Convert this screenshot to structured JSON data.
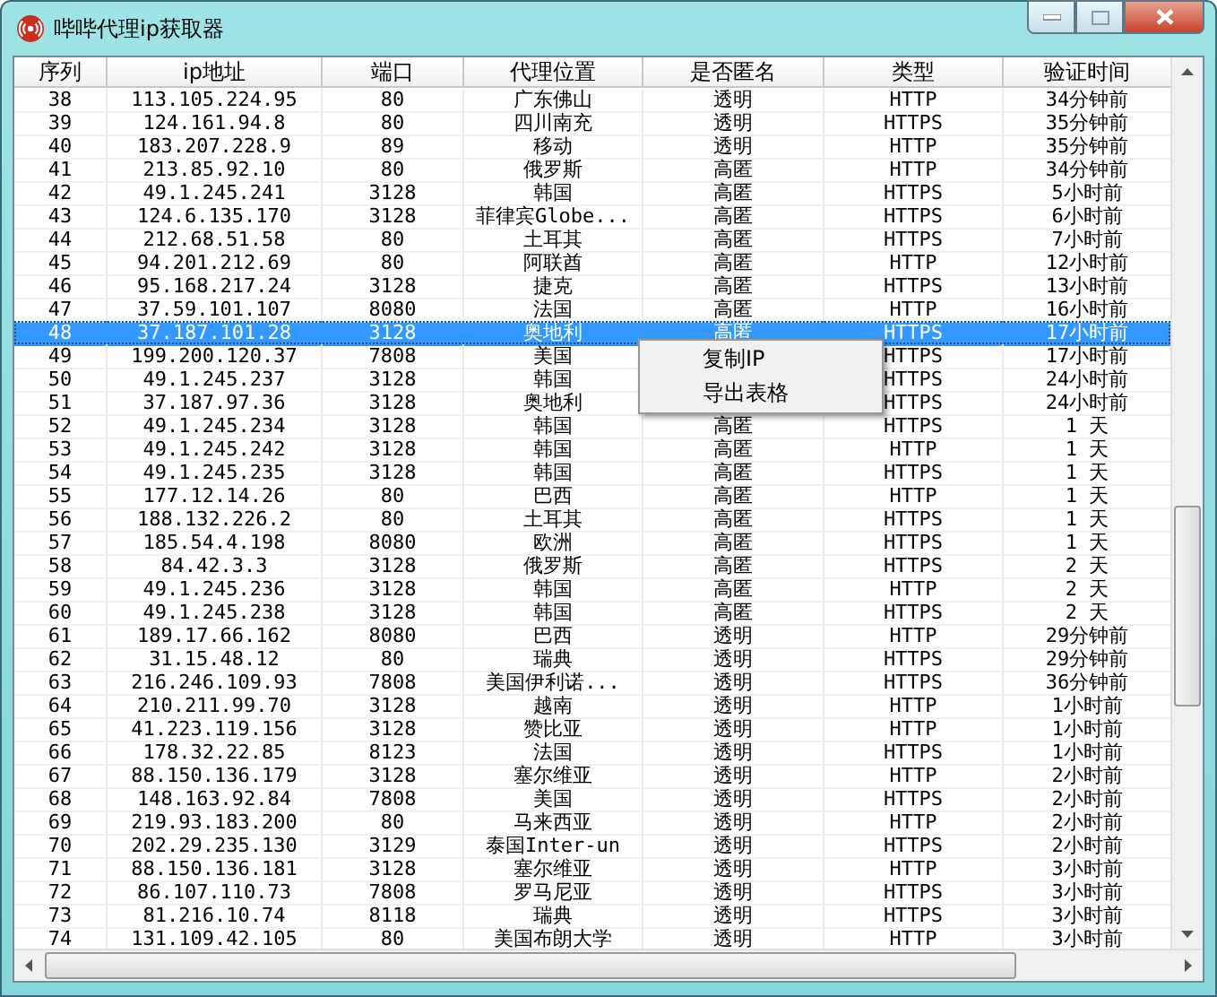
{
  "window": {
    "title": "哔哔代理ip获取器"
  },
  "table": {
    "columns": [
      "序列",
      "ip地址",
      "端口",
      "代理位置",
      "是否匿名",
      "类型",
      "验证时间"
    ],
    "rows": [
      {
        "index": "38",
        "ip": "113.105.224.95",
        "port": "80",
        "location": "广东佛山",
        "anonymity": "透明",
        "type": "HTTP",
        "verified": "34分钟前",
        "selected": false
      },
      {
        "index": "39",
        "ip": "124.161.94.8",
        "port": "80",
        "location": "四川南充",
        "anonymity": "透明",
        "type": "HTTPS",
        "verified": "35分钟前",
        "selected": false
      },
      {
        "index": "40",
        "ip": "183.207.228.9",
        "port": "89",
        "location": "移动",
        "anonymity": "透明",
        "type": "HTTP",
        "verified": "35分钟前",
        "selected": false
      },
      {
        "index": "41",
        "ip": "213.85.92.10",
        "port": "80",
        "location": "俄罗斯",
        "anonymity": "高匿",
        "type": "HTTP",
        "verified": "34分钟前",
        "selected": false
      },
      {
        "index": "42",
        "ip": "49.1.245.241",
        "port": "3128",
        "location": "韩国",
        "anonymity": "高匿",
        "type": "HTTPS",
        "verified": "5小时前",
        "selected": false
      },
      {
        "index": "43",
        "ip": "124.6.135.170",
        "port": "3128",
        "location": "菲律宾Globe...",
        "anonymity": "高匿",
        "type": "HTTPS",
        "verified": "6小时前",
        "selected": false
      },
      {
        "index": "44",
        "ip": "212.68.51.58",
        "port": "80",
        "location": "土耳其",
        "anonymity": "高匿",
        "type": "HTTPS",
        "verified": "7小时前",
        "selected": false
      },
      {
        "index": "45",
        "ip": "94.201.212.69",
        "port": "80",
        "location": "阿联酋",
        "anonymity": "高匿",
        "type": "HTTP",
        "verified": "12小时前",
        "selected": false
      },
      {
        "index": "46",
        "ip": "95.168.217.24",
        "port": "3128",
        "location": "捷克",
        "anonymity": "高匿",
        "type": "HTTPS",
        "verified": "13小时前",
        "selected": false
      },
      {
        "index": "47",
        "ip": "37.59.101.107",
        "port": "8080",
        "location": "法国",
        "anonymity": "高匿",
        "type": "HTTP",
        "verified": "16小时前",
        "selected": false
      },
      {
        "index": "48",
        "ip": "37.187.101.28",
        "port": "3128",
        "location": "奥地利",
        "anonymity": "高匿",
        "type": "HTTPS",
        "verified": "17小时前",
        "selected": true
      },
      {
        "index": "49",
        "ip": "199.200.120.37",
        "port": "7808",
        "location": "美国",
        "type": "HTTPS",
        "verified": "17小时前",
        "selected": false
      },
      {
        "index": "50",
        "ip": "49.1.245.237",
        "port": "3128",
        "location": "韩国",
        "type": "HTTPS",
        "verified": "24小时前",
        "selected": false
      },
      {
        "index": "51",
        "ip": "37.187.97.36",
        "port": "3128",
        "location": "奥地利",
        "type": "HTTPS",
        "verified": "24小时前",
        "selected": false
      },
      {
        "index": "52",
        "ip": "49.1.245.234",
        "port": "3128",
        "location": "韩国",
        "anonymity": "高匿",
        "type": "HTTPS",
        "verified": "1 天",
        "selected": false
      },
      {
        "index": "53",
        "ip": "49.1.245.242",
        "port": "3128",
        "location": "韩国",
        "anonymity": "高匿",
        "type": "HTTP",
        "verified": "1 天",
        "selected": false
      },
      {
        "index": "54",
        "ip": "49.1.245.235",
        "port": "3128",
        "location": "韩国",
        "anonymity": "高匿",
        "type": "HTTPS",
        "verified": "1 天",
        "selected": false
      },
      {
        "index": "55",
        "ip": "177.12.14.26",
        "port": "80",
        "location": "巴西",
        "anonymity": "高匿",
        "type": "HTTP",
        "verified": "1 天",
        "selected": false
      },
      {
        "index": "56",
        "ip": "188.132.226.2",
        "port": "80",
        "location": "土耳其",
        "anonymity": "高匿",
        "type": "HTTPS",
        "verified": "1 天",
        "selected": false
      },
      {
        "index": "57",
        "ip": "185.54.4.198",
        "port": "8080",
        "location": "欧洲",
        "anonymity": "高匿",
        "type": "HTTPS",
        "verified": "1 天",
        "selected": false
      },
      {
        "index": "58",
        "ip": "84.42.3.3",
        "port": "3128",
        "location": "俄罗斯",
        "anonymity": "高匿",
        "type": "HTTPS",
        "verified": "2 天",
        "selected": false
      },
      {
        "index": "59",
        "ip": "49.1.245.236",
        "port": "3128",
        "location": "韩国",
        "anonymity": "高匿",
        "type": "HTTP",
        "verified": "2 天",
        "selected": false
      },
      {
        "index": "60",
        "ip": "49.1.245.238",
        "port": "3128",
        "location": "韩国",
        "anonymity": "高匿",
        "type": "HTTPS",
        "verified": "2 天",
        "selected": false
      },
      {
        "index": "61",
        "ip": "189.17.66.162",
        "port": "8080",
        "location": "巴西",
        "anonymity": "透明",
        "type": "HTTP",
        "verified": "29分钟前",
        "selected": false
      },
      {
        "index": "62",
        "ip": "31.15.48.12",
        "port": "80",
        "location": "瑞典",
        "anonymity": "透明",
        "type": "HTTPS",
        "verified": "29分钟前",
        "selected": false
      },
      {
        "index": "63",
        "ip": "216.246.109.93",
        "port": "7808",
        "location": "美国伊利诺...",
        "anonymity": "透明",
        "type": "HTTPS",
        "verified": "36分钟前",
        "selected": false
      },
      {
        "index": "64",
        "ip": "210.211.99.70",
        "port": "3128",
        "location": "越南",
        "anonymity": "透明",
        "type": "HTTP",
        "verified": "1小时前",
        "selected": false
      },
      {
        "index": "65",
        "ip": "41.223.119.156",
        "port": "3128",
        "location": "赞比亚",
        "anonymity": "透明",
        "type": "HTTP",
        "verified": "1小时前",
        "selected": false
      },
      {
        "index": "66",
        "ip": "178.32.22.85",
        "port": "8123",
        "location": "法国",
        "anonymity": "透明",
        "type": "HTTPS",
        "verified": "1小时前",
        "selected": false
      },
      {
        "index": "67",
        "ip": "88.150.136.179",
        "port": "3128",
        "location": "塞尔维亚",
        "anonymity": "透明",
        "type": "HTTP",
        "verified": "2小时前",
        "selected": false
      },
      {
        "index": "68",
        "ip": "148.163.92.84",
        "port": "7808",
        "location": "美国",
        "anonymity": "透明",
        "type": "HTTPS",
        "verified": "2小时前",
        "selected": false
      },
      {
        "index": "69",
        "ip": "219.93.183.200",
        "port": "80",
        "location": "马来西亚",
        "anonymity": "透明",
        "type": "HTTP",
        "verified": "2小时前",
        "selected": false
      },
      {
        "index": "70",
        "ip": "202.29.235.130",
        "port": "3129",
        "location": "泰国Inter-un",
        "anonymity": "透明",
        "type": "HTTPS",
        "verified": "2小时前",
        "selected": false
      },
      {
        "index": "71",
        "ip": "88.150.136.181",
        "port": "3128",
        "location": "塞尔维亚",
        "anonymity": "透明",
        "type": "HTTP",
        "verified": "3小时前",
        "selected": false
      },
      {
        "index": "72",
        "ip": "86.107.110.73",
        "port": "7808",
        "location": "罗马尼亚",
        "anonymity": "透明",
        "type": "HTTPS",
        "verified": "3小时前",
        "selected": false
      },
      {
        "index": "73",
        "ip": "81.216.10.74",
        "port": "8118",
        "location": "瑞典",
        "anonymity": "透明",
        "type": "HTTPS",
        "verified": "3小时前",
        "selected": false
      },
      {
        "index": "74",
        "ip": "131.109.42.105",
        "port": "80",
        "location": "美国布朗大学",
        "anonymity": "透明",
        "type": "HTTP",
        "verified": "3小时前",
        "selected": false
      }
    ]
  },
  "context_menu": {
    "items": [
      {
        "label": "复制IP"
      },
      {
        "label": "导出表格"
      }
    ]
  }
}
